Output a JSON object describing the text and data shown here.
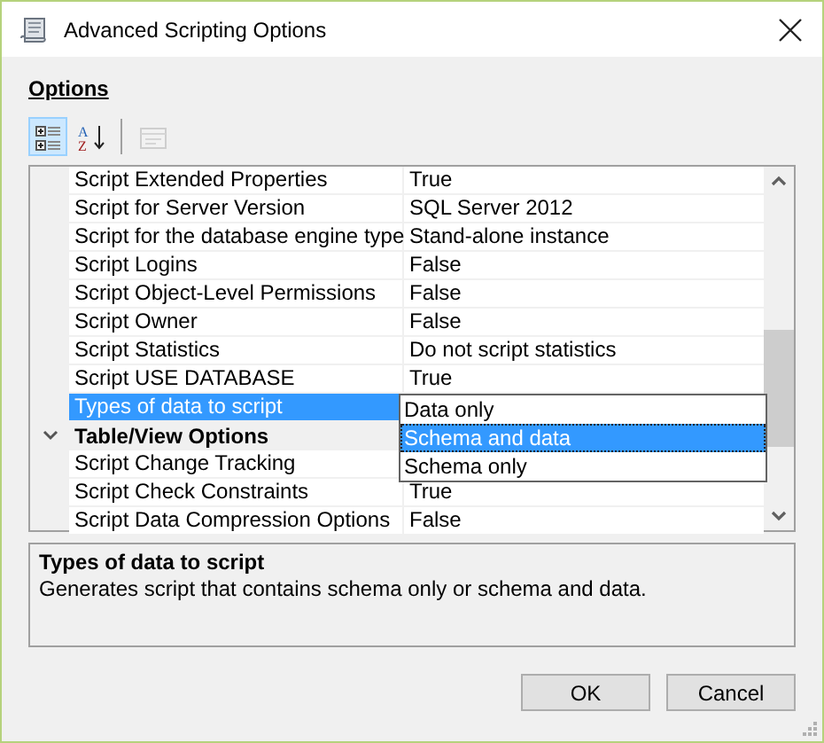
{
  "window": {
    "title": "Advanced Scripting Options"
  },
  "section_label": "Options",
  "toolbar": [
    {
      "kind": "categorized",
      "selected": true,
      "disabled": false
    },
    {
      "kind": "alphabetical",
      "letters": [
        "A",
        "Z"
      ],
      "selected": false,
      "disabled": false
    },
    {
      "kind": "separator"
    },
    {
      "kind": "property_pages",
      "selected": false,
      "disabled": true
    }
  ],
  "grid": {
    "rows": [
      {
        "kind": "property",
        "name": "Script Extended Properties",
        "value": "True",
        "selected": false
      },
      {
        "kind": "property",
        "name": "Script for Server Version",
        "value": "SQL Server 2012",
        "selected": false
      },
      {
        "kind": "property",
        "name": "Script for the database engine type",
        "value": "Stand-alone instance",
        "selected": false
      },
      {
        "kind": "property",
        "name": "Script Logins",
        "value": "False",
        "selected": false
      },
      {
        "kind": "property",
        "name": "Script Object-Level Permissions",
        "value": "False",
        "selected": false
      },
      {
        "kind": "property",
        "name": "Script Owner",
        "value": "False",
        "selected": false
      },
      {
        "kind": "property",
        "name": "Script Statistics",
        "value": "Do not script statistics",
        "selected": false
      },
      {
        "kind": "property",
        "name": "Script USE DATABASE",
        "value": "True",
        "selected": false
      },
      {
        "kind": "property",
        "name": "Types of data to script",
        "selected": true
      },
      {
        "kind": "category",
        "name": "Table/View Options",
        "expanded": true
      },
      {
        "kind": "property",
        "name": "Script Change Tracking",
        "selected": false
      },
      {
        "kind": "property",
        "name": "Script Check Constraints",
        "value": "True",
        "selected": false
      },
      {
        "kind": "property",
        "name": "Script Data Compression Options",
        "value": "False",
        "selected": false
      }
    ],
    "dropdown": {
      "open": true,
      "options": [
        {
          "label": "Data only",
          "selected": false
        },
        {
          "label": "Schema and data",
          "selected": true
        },
        {
          "label": "Schema only",
          "selected": false
        }
      ]
    }
  },
  "description": {
    "title": "Types of data to script",
    "text": "Generates script that contains schema only or schema and data."
  },
  "buttons": [
    "OK",
    "Cancel"
  ]
}
